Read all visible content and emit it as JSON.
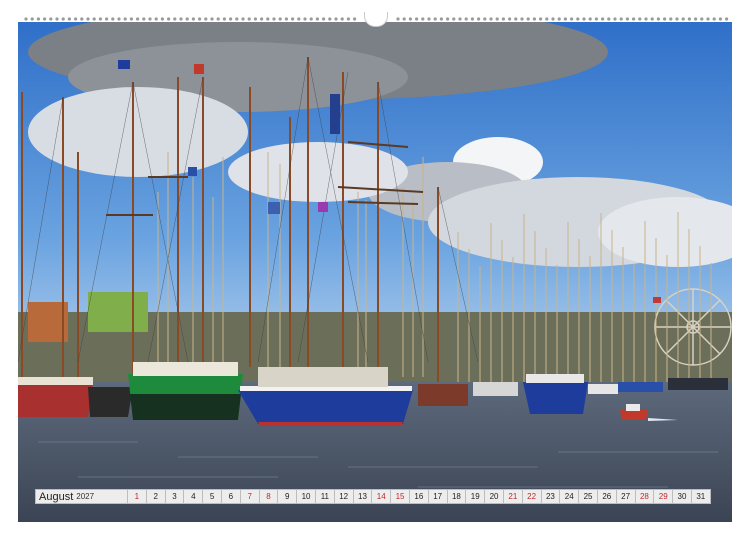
{
  "calendar": {
    "month": "August",
    "year": "2027",
    "days": [
      {
        "n": "1",
        "weekend": true
      },
      {
        "n": "2",
        "weekend": false
      },
      {
        "n": "3",
        "weekend": false
      },
      {
        "n": "4",
        "weekend": false
      },
      {
        "n": "5",
        "weekend": false
      },
      {
        "n": "6",
        "weekend": false
      },
      {
        "n": "7",
        "weekend": true
      },
      {
        "n": "8",
        "weekend": true
      },
      {
        "n": "9",
        "weekend": false
      },
      {
        "n": "10",
        "weekend": false
      },
      {
        "n": "11",
        "weekend": false
      },
      {
        "n": "12",
        "weekend": false
      },
      {
        "n": "13",
        "weekend": false
      },
      {
        "n": "14",
        "weekend": true
      },
      {
        "n": "15",
        "weekend": true
      },
      {
        "n": "16",
        "weekend": false
      },
      {
        "n": "17",
        "weekend": false
      },
      {
        "n": "18",
        "weekend": false
      },
      {
        "n": "19",
        "weekend": false
      },
      {
        "n": "20",
        "weekend": false
      },
      {
        "n": "21",
        "weekend": true
      },
      {
        "n": "22",
        "weekend": true
      },
      {
        "n": "23",
        "weekend": false
      },
      {
        "n": "24",
        "weekend": false
      },
      {
        "n": "25",
        "weekend": false
      },
      {
        "n": "26",
        "weekend": false
      },
      {
        "n": "27",
        "weekend": false
      },
      {
        "n": "28",
        "weekend": true
      },
      {
        "n": "29",
        "weekend": true
      },
      {
        "n": "30",
        "weekend": false
      },
      {
        "n": "31",
        "weekend": false
      }
    ]
  },
  "colors": {
    "sky_top": "#2f6fc8",
    "sky_bottom": "#9cc3ea",
    "water": "#4a5566",
    "weekend": "#c0272d",
    "hull_green": "#1e8a3c",
    "hull_blue": "#1d3c9c",
    "hull_red": "#a8302e"
  }
}
